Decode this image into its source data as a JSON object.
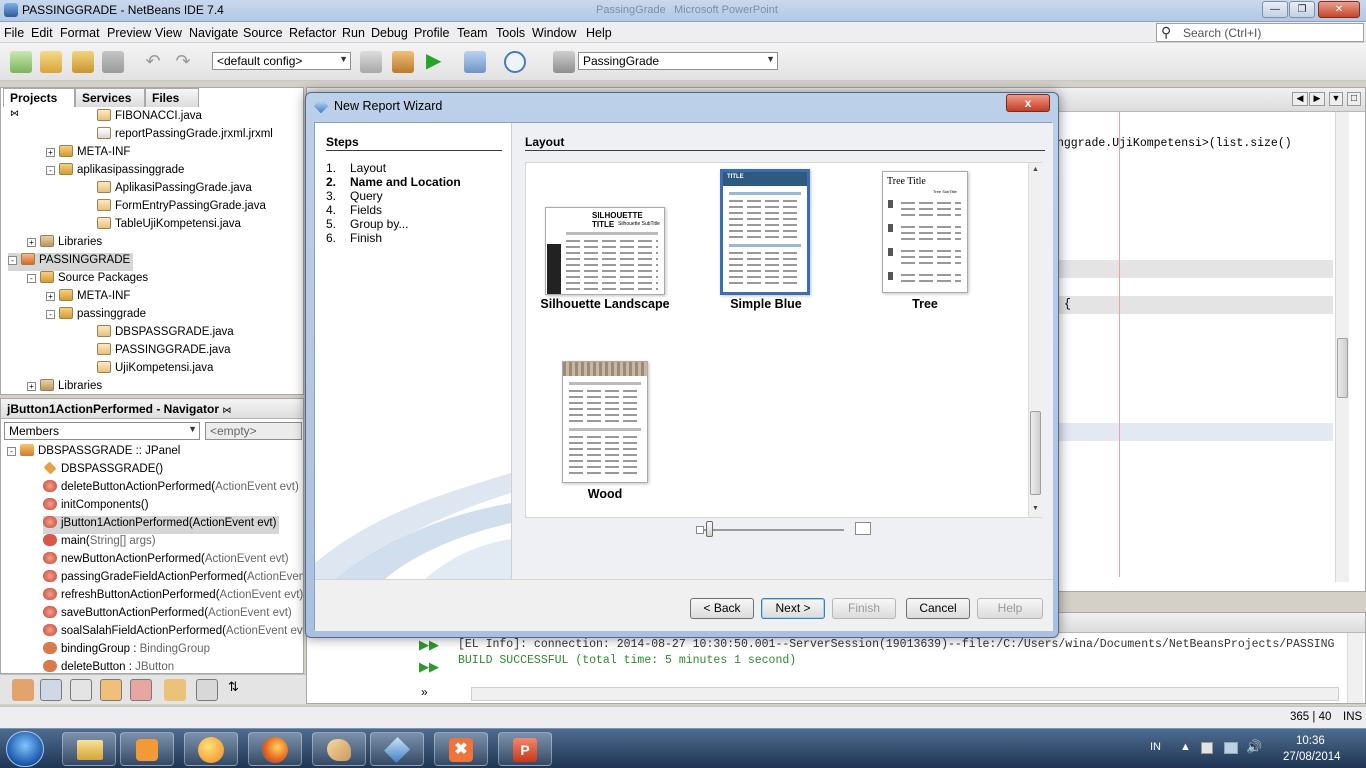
{
  "window": {
    "title": "PASSINGGRADE - NetBeans IDE 7.4",
    "ghost_titles": [
      "PassingGrade",
      "Microsoft PowerPoint"
    ]
  },
  "menu": [
    "File",
    "Edit",
    "Format",
    "Preview",
    "View",
    "Navigate",
    "Source",
    "Refactor",
    "Run",
    "Debug",
    "Profile",
    "Team",
    "Tools",
    "Window",
    "Help"
  ],
  "search": {
    "placeholder": "Search (Ctrl+I)"
  },
  "toolbar": {
    "config": "<default config>",
    "project": "PassingGrade"
  },
  "left_tabs": [
    "Projects",
    "Services",
    "Files"
  ],
  "project_tree": [
    {
      "label": "FIBONACCI.java",
      "indent": 5,
      "kind": "java"
    },
    {
      "label": "reportPassingGrade.jrxml.jrxml",
      "indent": 5,
      "kind": "report"
    },
    {
      "label": "META-INF",
      "indent": 3,
      "kind": "package",
      "exp": "+"
    },
    {
      "label": "aplikasipassinggrade",
      "indent": 3,
      "kind": "package",
      "exp": "-"
    },
    {
      "label": "AplikasiPassingGrade.java",
      "indent": 5,
      "kind": "java"
    },
    {
      "label": "FormEntryPassingGrade.java",
      "indent": 5,
      "kind": "java"
    },
    {
      "label": "TableUjiKompetensi.java",
      "indent": 5,
      "kind": "java"
    },
    {
      "label": "Libraries",
      "indent": 2,
      "kind": "lib",
      "exp": "+"
    },
    {
      "label": "PASSINGGRADE",
      "indent": 1,
      "kind": "project",
      "exp": "-"
    },
    {
      "label": "Source Packages",
      "indent": 2,
      "kind": "src",
      "exp": "-"
    },
    {
      "label": "META-INF",
      "indent": 3,
      "kind": "package",
      "exp": "+"
    },
    {
      "label": "passinggrade",
      "indent": 3,
      "kind": "package",
      "exp": "-"
    },
    {
      "label": "DBSPASSGRADE.java",
      "indent": 5,
      "kind": "java"
    },
    {
      "label": "PASSINGGRADE.java",
      "indent": 5,
      "kind": "java"
    },
    {
      "label": "UjiKompetensi.java",
      "indent": 5,
      "kind": "java"
    },
    {
      "label": "Libraries",
      "indent": 2,
      "kind": "lib",
      "exp": "+"
    }
  ],
  "navigator": {
    "title": "jButton1ActionPerformed - Navigator",
    "members_label": "Members",
    "filter_placeholder": "<empty>",
    "root": "DBSPASSGRADE :: JPanel",
    "items": [
      {
        "name": "DBSPASSGRADE()",
        "param": "",
        "kind": "ctor"
      },
      {
        "name": "deleteButtonActionPerformed(",
        "param": "ActionEvent evt)",
        "kind": "method"
      },
      {
        "name": "initComponents()",
        "param": "",
        "kind": "method"
      },
      {
        "name": "jButton1ActionPerformed(ActionEvent evt)",
        "param": "",
        "kind": "method",
        "selected": true
      },
      {
        "name": "main(",
        "param": "String[] args)",
        "kind": "static"
      },
      {
        "name": "newButtonActionPerformed(",
        "param": "ActionEvent evt)",
        "kind": "method"
      },
      {
        "name": "passingGradeFieldActionPerformed(",
        "param": "ActionEvent e",
        "kind": "method"
      },
      {
        "name": "refreshButtonActionPerformed(",
        "param": "ActionEvent evt)",
        "kind": "method"
      },
      {
        "name": "saveButtonActionPerformed(",
        "param": "ActionEvent evt)",
        "kind": "method"
      },
      {
        "name": "soalSalahFieldActionPerformed(",
        "param": "ActionEvent evt)",
        "kind": "method"
      },
      {
        "name": "bindingGroup : ",
        "param": "BindingGroup",
        "kind": "field"
      },
      {
        "name": "deleteButton : ",
        "param": "JButton",
        "kind": "field"
      }
    ]
  },
  "editor": {
    "code_fragment": "nggrade.UjiKompetensi>(list.size()",
    "brace": "{"
  },
  "output": {
    "line1": "[EL Info]: connection: 2014-08-27 10:30:50.001--ServerSession(19013639)--file:/C:/Users/wina/Documents/NetBeansProjects/PASSING",
    "line2": "BUILD SUCCESSFUL (total time: 5 minutes 1 second)"
  },
  "status": {
    "position": "365 | 40",
    "mode": "INS"
  },
  "taskbar": {
    "lang": "IN",
    "time": "10:36",
    "date": "27/08/2014"
  },
  "dialog": {
    "title": "New Report Wizard",
    "close": "x",
    "steps_title": "Steps",
    "steps": [
      {
        "n": "1.",
        "label": "Layout",
        "bold": false
      },
      {
        "n": "2.",
        "label": "Name and Location",
        "bold": true
      },
      {
        "n": "3.",
        "label": "Query",
        "bold": false
      },
      {
        "n": "4.",
        "label": "Fields",
        "bold": false
      },
      {
        "n": "5.",
        "label": "Group by...",
        "bold": false
      },
      {
        "n": "6.",
        "label": "Finish",
        "bold": false
      }
    ],
    "layout_title": "Layout",
    "templates": [
      {
        "label": "Silhouette Landscape",
        "thumb_title": "SILHOUETTE TITLE",
        "thumb_sub": "Silhouette SubTitle"
      },
      {
        "label": "Simple Blue",
        "thumb_title": "TITLE",
        "selected": true
      },
      {
        "label": "Tree",
        "thumb_title": "Tree Title",
        "thumb_sub": "Tree SubTitle"
      },
      {
        "label": "Wood",
        "thumb_title": ""
      }
    ],
    "buttons": {
      "back": "< Back",
      "next": "Next >",
      "finish": "Finish",
      "cancel": "Cancel",
      "help": "Help"
    }
  },
  "colors": {
    "accent": "#3d6cb6",
    "selection": "#d6d6d6",
    "output_green": "#2e8b2e"
  }
}
